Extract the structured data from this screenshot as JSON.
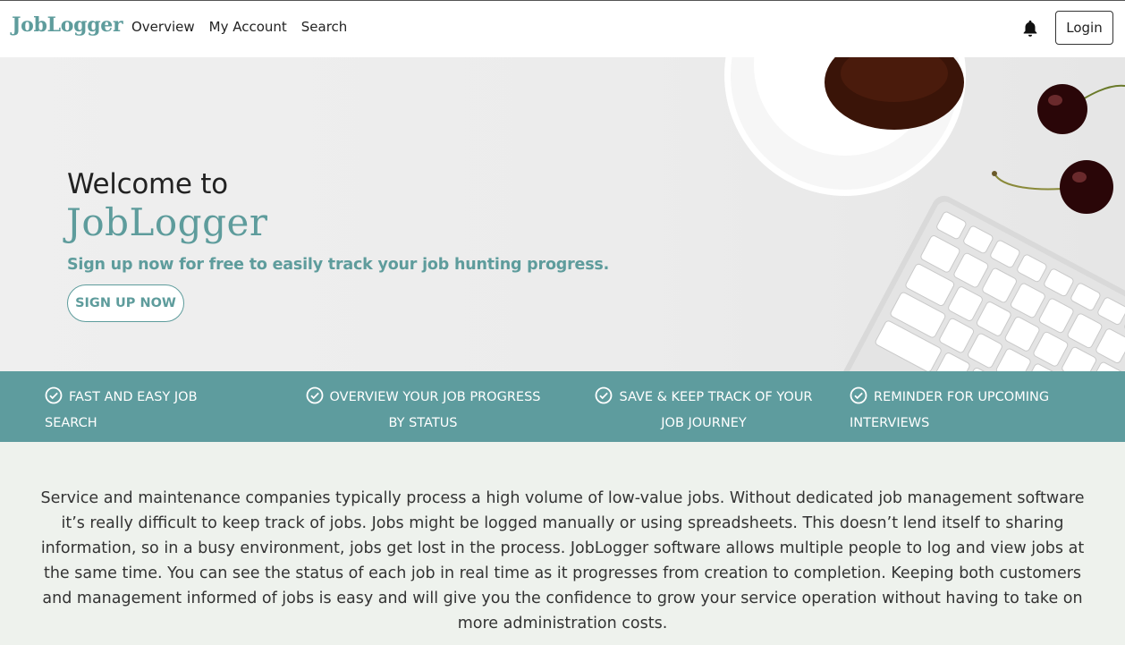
{
  "nav": {
    "brand": "JobLogger",
    "links": [
      "Overview",
      "My Account",
      "Search"
    ],
    "bell_icon": "bell-icon",
    "login_label": "Login"
  },
  "hero": {
    "welcome": "Welcome to",
    "brand": "JobLogger",
    "subtitle": "Sign up now for free to easily track your job hunting progress.",
    "cta_label": "SIGN UP NOW"
  },
  "features": [
    {
      "icon": "check-circle-icon",
      "label": "FAST AND EASY JOB SEARCH"
    },
    {
      "icon": "check-circle-icon",
      "label": "OVERVIEW YOUR JOB PROGRESS BY STATUS"
    },
    {
      "icon": "check-circle-icon",
      "label": "SAVE & KEEP TRACK OF YOUR JOB JOURNEY"
    },
    {
      "icon": "check-circle-icon",
      "label": "REMINDER FOR UPCOMING INTERVIEWS"
    }
  ],
  "intro": "Service and maintenance companies typically process a high volume of low-value jobs. Without dedicated job management software it’s really difficult to keep track of jobs. Jobs might be logged manually or using spreadsheets. This doesn’t lend itself to sharing information, so in a busy environment, jobs get lost in the process. JobLogger software allows multiple people to log and view jobs at the same time. You can see the status of each job in real time as it progresses from creation to completion. Keeping both customers and management informed of jobs is easy and will give you the confidence to grow your service operation without having to take on more administration costs.",
  "colors": {
    "accent": "#5e9c9c",
    "band": "#5e9c9e",
    "page_bg": "#eef2ed"
  }
}
